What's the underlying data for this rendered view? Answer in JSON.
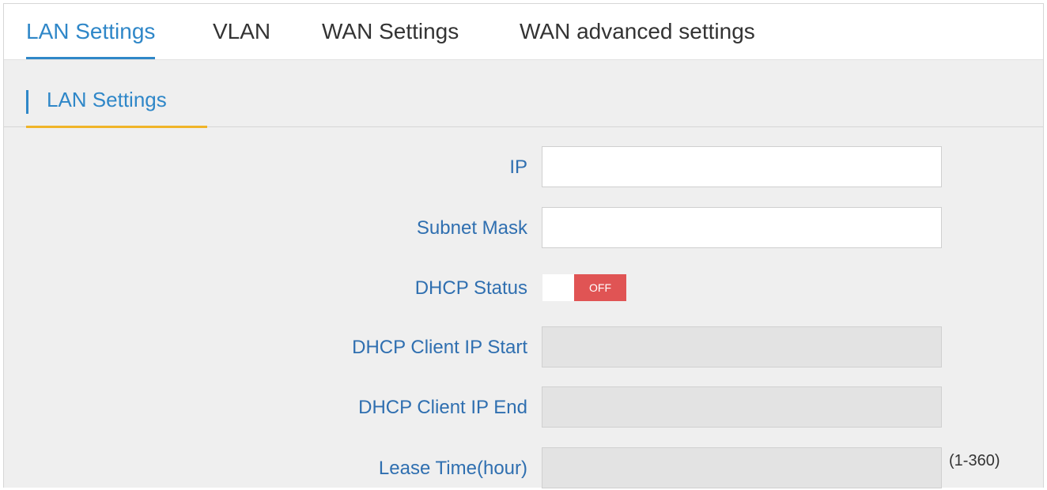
{
  "tabs": [
    {
      "label": "LAN Settings",
      "active": true
    },
    {
      "label": "VLAN",
      "active": false
    },
    {
      "label": "WAN Settings",
      "active": false
    },
    {
      "label": "WAN advanced settings",
      "active": false
    }
  ],
  "section": {
    "title": "LAN Settings"
  },
  "form": {
    "ip": {
      "label": "IP",
      "value": ""
    },
    "subnet_mask": {
      "label": "Subnet Mask",
      "value": ""
    },
    "dhcp_status": {
      "label": "DHCP Status",
      "state": "OFF"
    },
    "dhcp_start": {
      "label": "DHCP Client IP Start",
      "value": ""
    },
    "dhcp_end": {
      "label": "DHCP Client IP End",
      "value": ""
    },
    "lease_time": {
      "label": "Lease Time(hour)",
      "value": "",
      "range_hint": "(1-360)"
    }
  },
  "colors": {
    "accent": "#2f87c8",
    "section_underline": "#f0b428",
    "toggle_off": "#e05454"
  }
}
